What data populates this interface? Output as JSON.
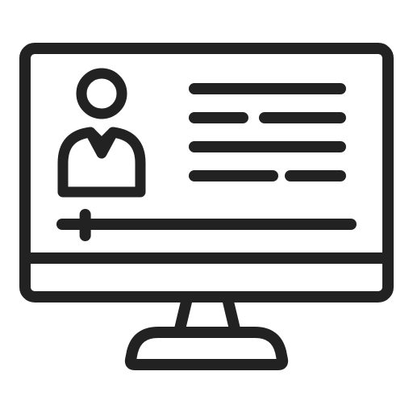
{
  "icon": {
    "name": "online-profile-monitor-icon",
    "stroke_color": "#222222",
    "background_color": "#ffffff",
    "parts": {
      "monitor": "monitor-icon",
      "avatar": "user-avatar-icon",
      "text_lines": "text-lines-icon",
      "slider": "progress-slider-icon",
      "stand": "monitor-stand-icon"
    },
    "slider_progress": 0.08
  }
}
